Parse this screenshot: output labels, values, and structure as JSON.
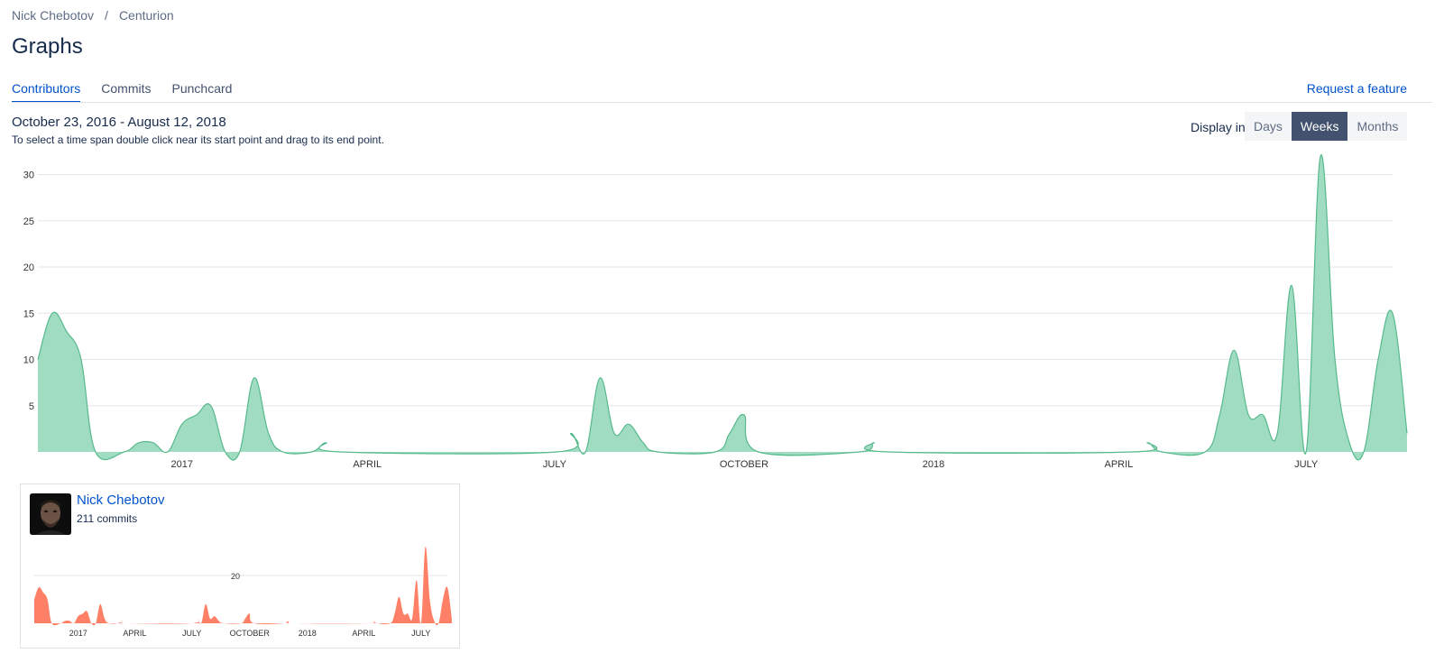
{
  "breadcrumb": {
    "owner": "Nick Chebotov",
    "separator": "/",
    "repo": "Centurion"
  },
  "page_title": "Graphs",
  "tabs": [
    {
      "label": "Contributors",
      "active": true
    },
    {
      "label": "Commits",
      "active": false
    },
    {
      "label": "Punchcard",
      "active": false
    }
  ],
  "request_feature": "Request a feature",
  "date_range": "October 23, 2016 - August 12, 2018",
  "hint": "To select a time span double click near its start point and drag to its end point.",
  "display": {
    "label": "Display in",
    "options": [
      "Days",
      "Weeks",
      "Months"
    ],
    "selected": "Weeks"
  },
  "colors": {
    "accent": "#0052cc",
    "main_area": "#9fdcc2",
    "main_line": "#57b98b",
    "contributor_area": "#ff8066"
  },
  "chart_data": [
    {
      "type": "area",
      "y_ticks": [
        5,
        10,
        15,
        20,
        25,
        30
      ],
      "ylim": [
        0,
        32
      ],
      "x_ticks": [
        "2017",
        "APRIL",
        "JULY",
        "OCTOBER",
        "2018",
        "APRIL",
        "JULY"
      ],
      "x_tick_dates": [
        "2017-01-01",
        "2017-04-01",
        "2017-07-01",
        "2017-10-01",
        "2018-01-01",
        "2018-04-01",
        "2018-07-01"
      ],
      "xlim": [
        "2016-10-23",
        "2018-08-12"
      ],
      "grid": true,
      "points": [
        [
          "2016-10-23",
          10
        ],
        [
          "2016-10-30",
          15
        ],
        [
          "2016-11-06",
          13
        ],
        [
          "2016-11-13",
          10
        ],
        [
          "2016-11-20",
          0
        ],
        [
          "2016-12-04",
          0
        ],
        [
          "2016-12-11",
          1
        ],
        [
          "2016-12-18",
          1
        ],
        [
          "2016-12-25",
          0
        ],
        [
          "2017-01-01",
          3
        ],
        [
          "2017-01-08",
          4
        ],
        [
          "2017-01-15",
          5
        ],
        [
          "2017-01-22",
          0
        ],
        [
          "2017-01-29",
          0
        ],
        [
          "2017-02-05",
          8
        ],
        [
          "2017-02-12",
          2
        ],
        [
          "2017-02-19",
          0
        ],
        [
          "2017-03-05",
          0
        ],
        [
          "2017-03-12",
          1
        ],
        [
          "2017-03-19",
          0
        ],
        [
          "2017-07-02",
          0
        ],
        [
          "2017-07-09",
          2
        ],
        [
          "2017-07-16",
          0
        ],
        [
          "2017-07-23",
          8
        ],
        [
          "2017-07-30",
          2
        ],
        [
          "2017-08-06",
          3
        ],
        [
          "2017-08-13",
          1
        ],
        [
          "2017-08-20",
          0
        ],
        [
          "2017-09-17",
          0
        ],
        [
          "2017-09-24",
          2
        ],
        [
          "2017-10-01",
          4
        ],
        [
          "2017-10-08",
          0
        ],
        [
          "2017-11-26",
          0
        ],
        [
          "2017-12-03",
          1
        ],
        [
          "2017-12-10",
          0
        ],
        [
          "2018-04-08",
          0
        ],
        [
          "2018-04-15",
          1
        ],
        [
          "2018-04-22",
          0
        ],
        [
          "2018-05-13",
          0
        ],
        [
          "2018-05-20",
          4
        ],
        [
          "2018-05-27",
          11
        ],
        [
          "2018-06-03",
          4
        ],
        [
          "2018-06-10",
          4
        ],
        [
          "2018-06-17",
          2
        ],
        [
          "2018-06-24",
          18
        ],
        [
          "2018-07-01",
          0
        ],
        [
          "2018-07-08",
          32
        ],
        [
          "2018-07-15",
          10
        ],
        [
          "2018-07-22",
          1
        ],
        [
          "2018-07-29",
          0
        ],
        [
          "2018-08-05",
          10
        ],
        [
          "2018-08-12",
          15
        ],
        [
          "2018-08-19",
          2
        ]
      ]
    },
    {
      "type": "area",
      "y_ticks": [
        20
      ],
      "ylim": [
        0,
        32
      ],
      "x_ticks": [
        "2017",
        "APRIL",
        "JULY",
        "OCTOBER",
        "2018",
        "APRIL",
        "JULY"
      ],
      "x_tick_dates": [
        "2017-01-01",
        "2017-04-01",
        "2017-07-01",
        "2017-10-01",
        "2018-01-01",
        "2018-04-01",
        "2018-07-01"
      ],
      "xlim": [
        "2016-10-23",
        "2018-08-12"
      ],
      "grid": true,
      "series_color": "#ff8066"
    }
  ],
  "contributor": {
    "name": "Nick Chebotov",
    "commits_label": "211 commits"
  }
}
